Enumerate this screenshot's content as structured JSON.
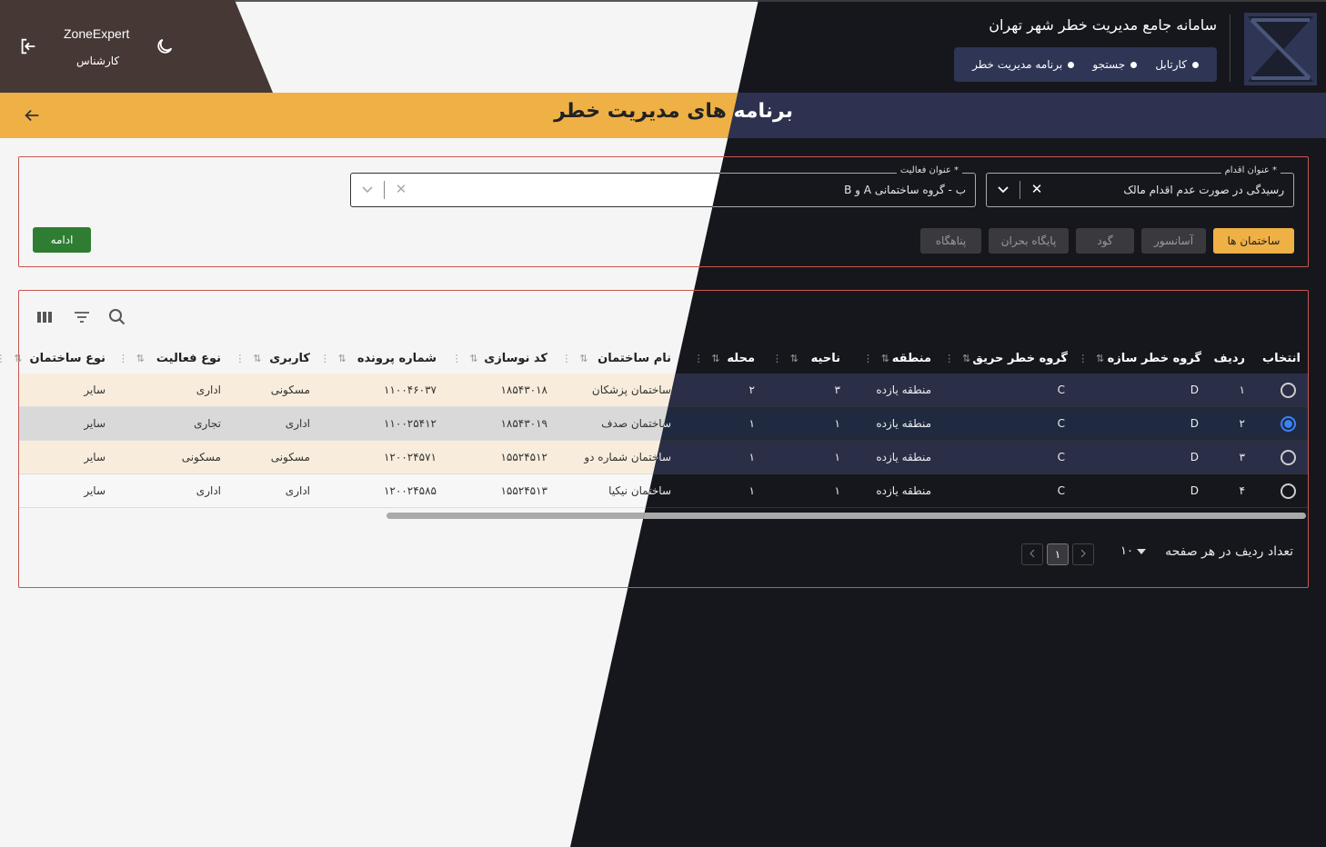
{
  "header": {
    "system_title": "سامانه جامع مدیریت خطر شهر تهران",
    "nav": [
      {
        "label": "کارتابل"
      },
      {
        "label": "جستجو"
      },
      {
        "label": "برنامه مدیریت خطر"
      }
    ],
    "user": {
      "name": "ZoneExpert",
      "role": "کارشناس"
    }
  },
  "page": {
    "title": "برنامه های مدیریت خطر"
  },
  "filters": {
    "action": {
      "label": "* عنوان اقدام",
      "value": "رسیدگی در صورت عدم اقدام مالک"
    },
    "activity": {
      "label": "* عنوان فعالیت",
      "value": "ب - گروه ساختمانی A و B"
    },
    "categories": [
      {
        "label": "ساختمان ها",
        "active": true
      },
      {
        "label": "آسانسور",
        "active": false
      },
      {
        "label": "گود",
        "active": false
      },
      {
        "label": "پایگاه بحران",
        "active": false
      },
      {
        "label": "پناهگاه",
        "active": false
      }
    ],
    "continue_label": "ادامه"
  },
  "table": {
    "columns": [
      "انتخاب",
      "ردیف",
      "گروه خطر سازه",
      "گروه خطر حریق",
      "منطقه",
      "ناحیه",
      "محله",
      "نام ساختمان",
      "کد نوسازی",
      "شماره پرونده",
      "کاربری",
      "نوع فعالیت",
      "نوع ساختمان"
    ],
    "rows": [
      {
        "selected": false,
        "row": "۱",
        "struct_risk": "D",
        "fire_risk": "C",
        "region": "منطقه یازده",
        "district": "۳",
        "neighborhood": "۲",
        "name": "ساختمان پزشکان",
        "code": "۱۸۵۴۳۰۱۸",
        "file_no": "۱۱۰۰۴۶۰۳۷",
        "usage": "مسکونی",
        "activity": "اداری",
        "type": "سایر"
      },
      {
        "selected": true,
        "row": "۲",
        "struct_risk": "D",
        "fire_risk": "C",
        "region": "منطقه یازده",
        "district": "۱",
        "neighborhood": "۱",
        "name": "ساختمان صدف",
        "code": "۱۸۵۴۳۰۱۹",
        "file_no": "۱۱۰۰۲۵۴۱۲",
        "usage": "اداری",
        "activity": "تجاری",
        "type": "سایر"
      },
      {
        "selected": false,
        "row": "۳",
        "struct_risk": "D",
        "fire_risk": "C",
        "region": "منطقه یازده",
        "district": "۱",
        "neighborhood": "۱",
        "name": "ساختمان شماره دو",
        "code": "۱۵۵۲۴۵۱۲",
        "file_no": "۱۲۰۰۲۴۵۷۱",
        "usage": "مسکونی",
        "activity": "مسکونی",
        "type": "سایر"
      },
      {
        "selected": false,
        "row": "۴",
        "struct_risk": "D",
        "fire_risk": "C",
        "region": "منطقه یازده",
        "district": "۱",
        "neighborhood": "۱",
        "name": "ساختمان نیکیا",
        "code": "۱۵۵۲۴۵۱۳",
        "file_no": "۱۲۰۰۲۴۵۸۵",
        "usage": "اداری",
        "activity": "اداری",
        "type": "سایر"
      }
    ]
  },
  "pagination": {
    "rows_label": "تعداد ردیف در هر صفحه",
    "page_size": "۱۰",
    "current_page": "۱"
  },
  "colors": {
    "accent_orange": "#efb045",
    "dark_bg": "#16171d",
    "navy": "#2e3250",
    "user_panel": "#463834",
    "continue_green": "#2e7d32",
    "border_red": "#c8564e",
    "radio_blue": "#3b82f6"
  },
  "icons": [
    "logout-icon",
    "moon-icon",
    "back-arrow-icon",
    "search-icon",
    "filter-icon",
    "columns-icon",
    "chevron-down-icon",
    "close-icon",
    "sort-icon",
    "column-menu-icon",
    "chevron-left-icon",
    "chevron-right-icon",
    "logo-icon"
  ]
}
